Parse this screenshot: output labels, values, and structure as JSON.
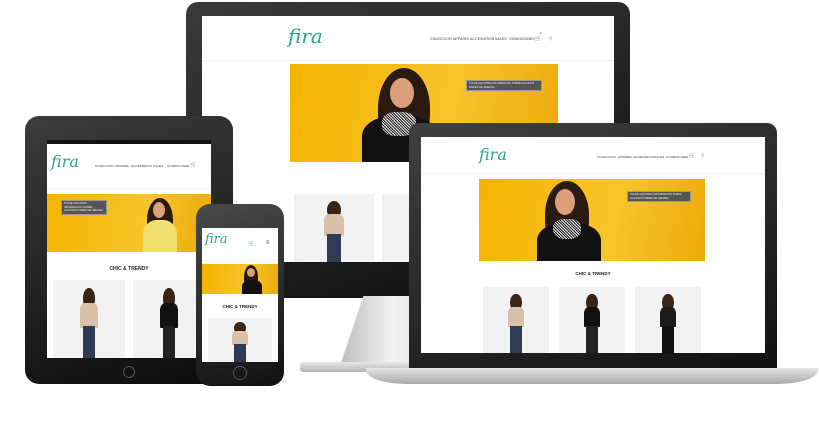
{
  "site": {
    "logo": "fira",
    "nav": [
      "COLECCION",
      "APPAREL",
      "ACCESORIOS",
      "SALES",
      "CONDICIONES"
    ],
    "cart_count": "0",
    "banner_info": "PULSE AQUI PARA INFORMACION SOBRE ALGUNOS FINDES DE SEMANA",
    "section_title": "CHIC & TRENDY"
  },
  "colors": {
    "brand": "#2aa58a",
    "banner": "#f4b400",
    "device_frame": "#1a1a1a"
  },
  "devices": [
    "desktop-monitor",
    "laptop",
    "tablet",
    "phone"
  ]
}
